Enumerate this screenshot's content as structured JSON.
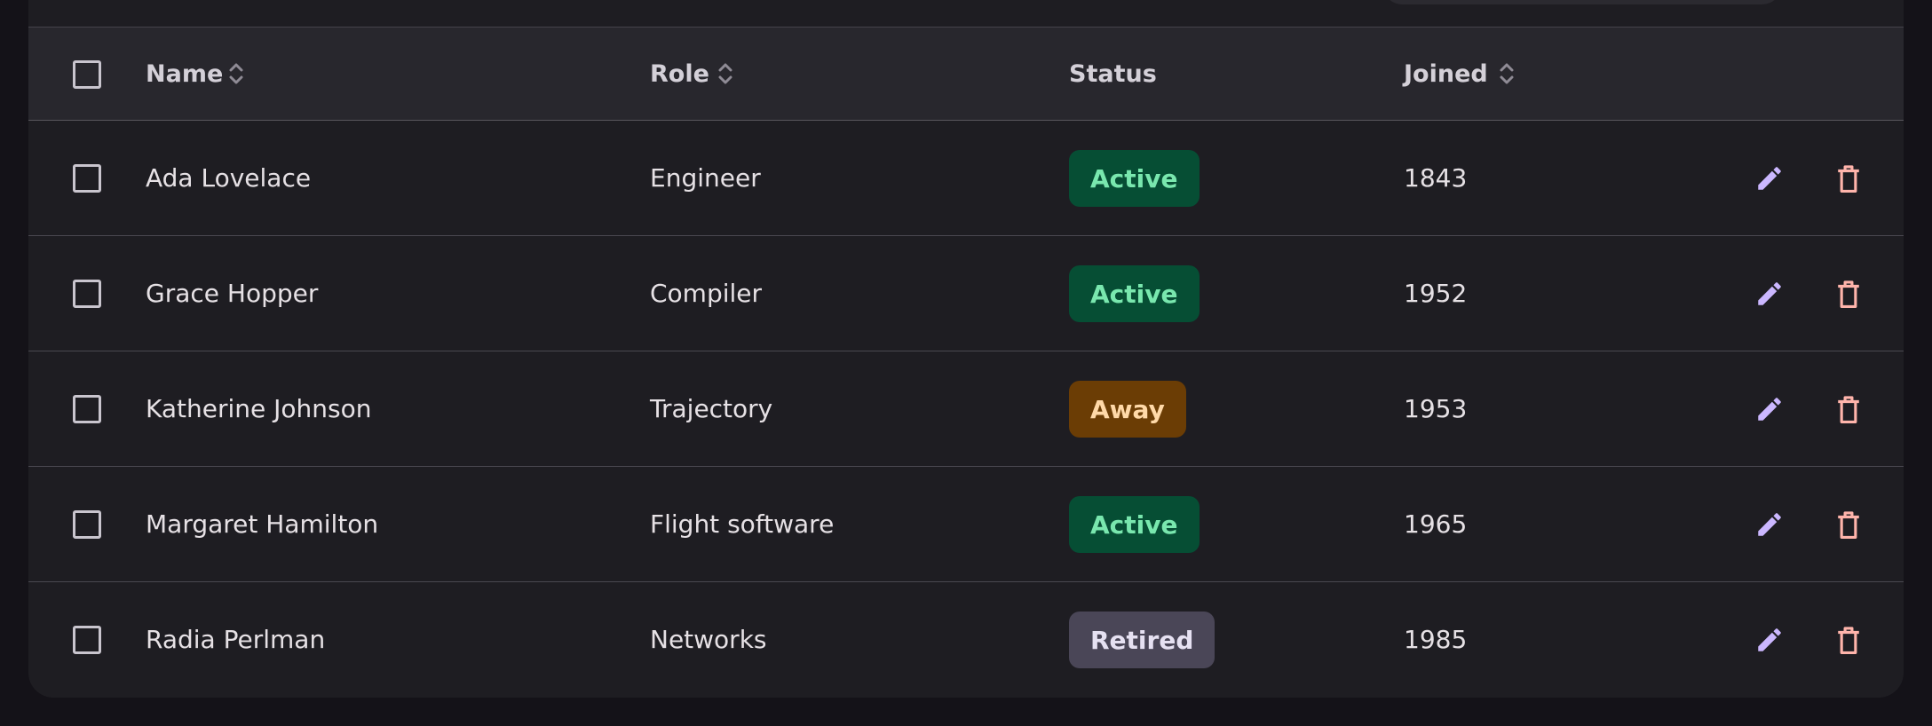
{
  "table": {
    "columns": {
      "name": "Name",
      "role": "Role",
      "status": "Status",
      "joined": "Joined"
    },
    "rows": [
      {
        "name": "Ada Lovelace",
        "role": "Engineer",
        "status": "Active",
        "joined": "1843"
      },
      {
        "name": "Grace Hopper",
        "role": "Compiler",
        "status": "Active",
        "joined": "1952"
      },
      {
        "name": "Katherine Johnson",
        "role": "Trajectory",
        "status": "Away",
        "joined": "1953"
      },
      {
        "name": "Margaret Hamilton",
        "role": "Flight software",
        "status": "Active",
        "joined": "1965"
      },
      {
        "name": "Radia Perlman",
        "role": "Networks",
        "status": "Retired",
        "joined": "1985"
      }
    ]
  },
  "icons": {
    "checkbox": "checkbox-icon",
    "sort": "sort-icon",
    "edit": "pencil-icon",
    "delete": "trash-icon"
  },
  "colors": {
    "background": "#141218",
    "card": "#1e1d22",
    "active_badge_bg": "#064e34",
    "active_badge_text": "#79e7ae",
    "away_badge_bg": "#6b3d05",
    "away_badge_text": "#ffd9a8",
    "retired_badge_bg": "#4a4657",
    "retired_badge_text": "#e6e1f2",
    "edit_icon": "#cbb7ff",
    "delete_icon": "#ffb4ab"
  }
}
